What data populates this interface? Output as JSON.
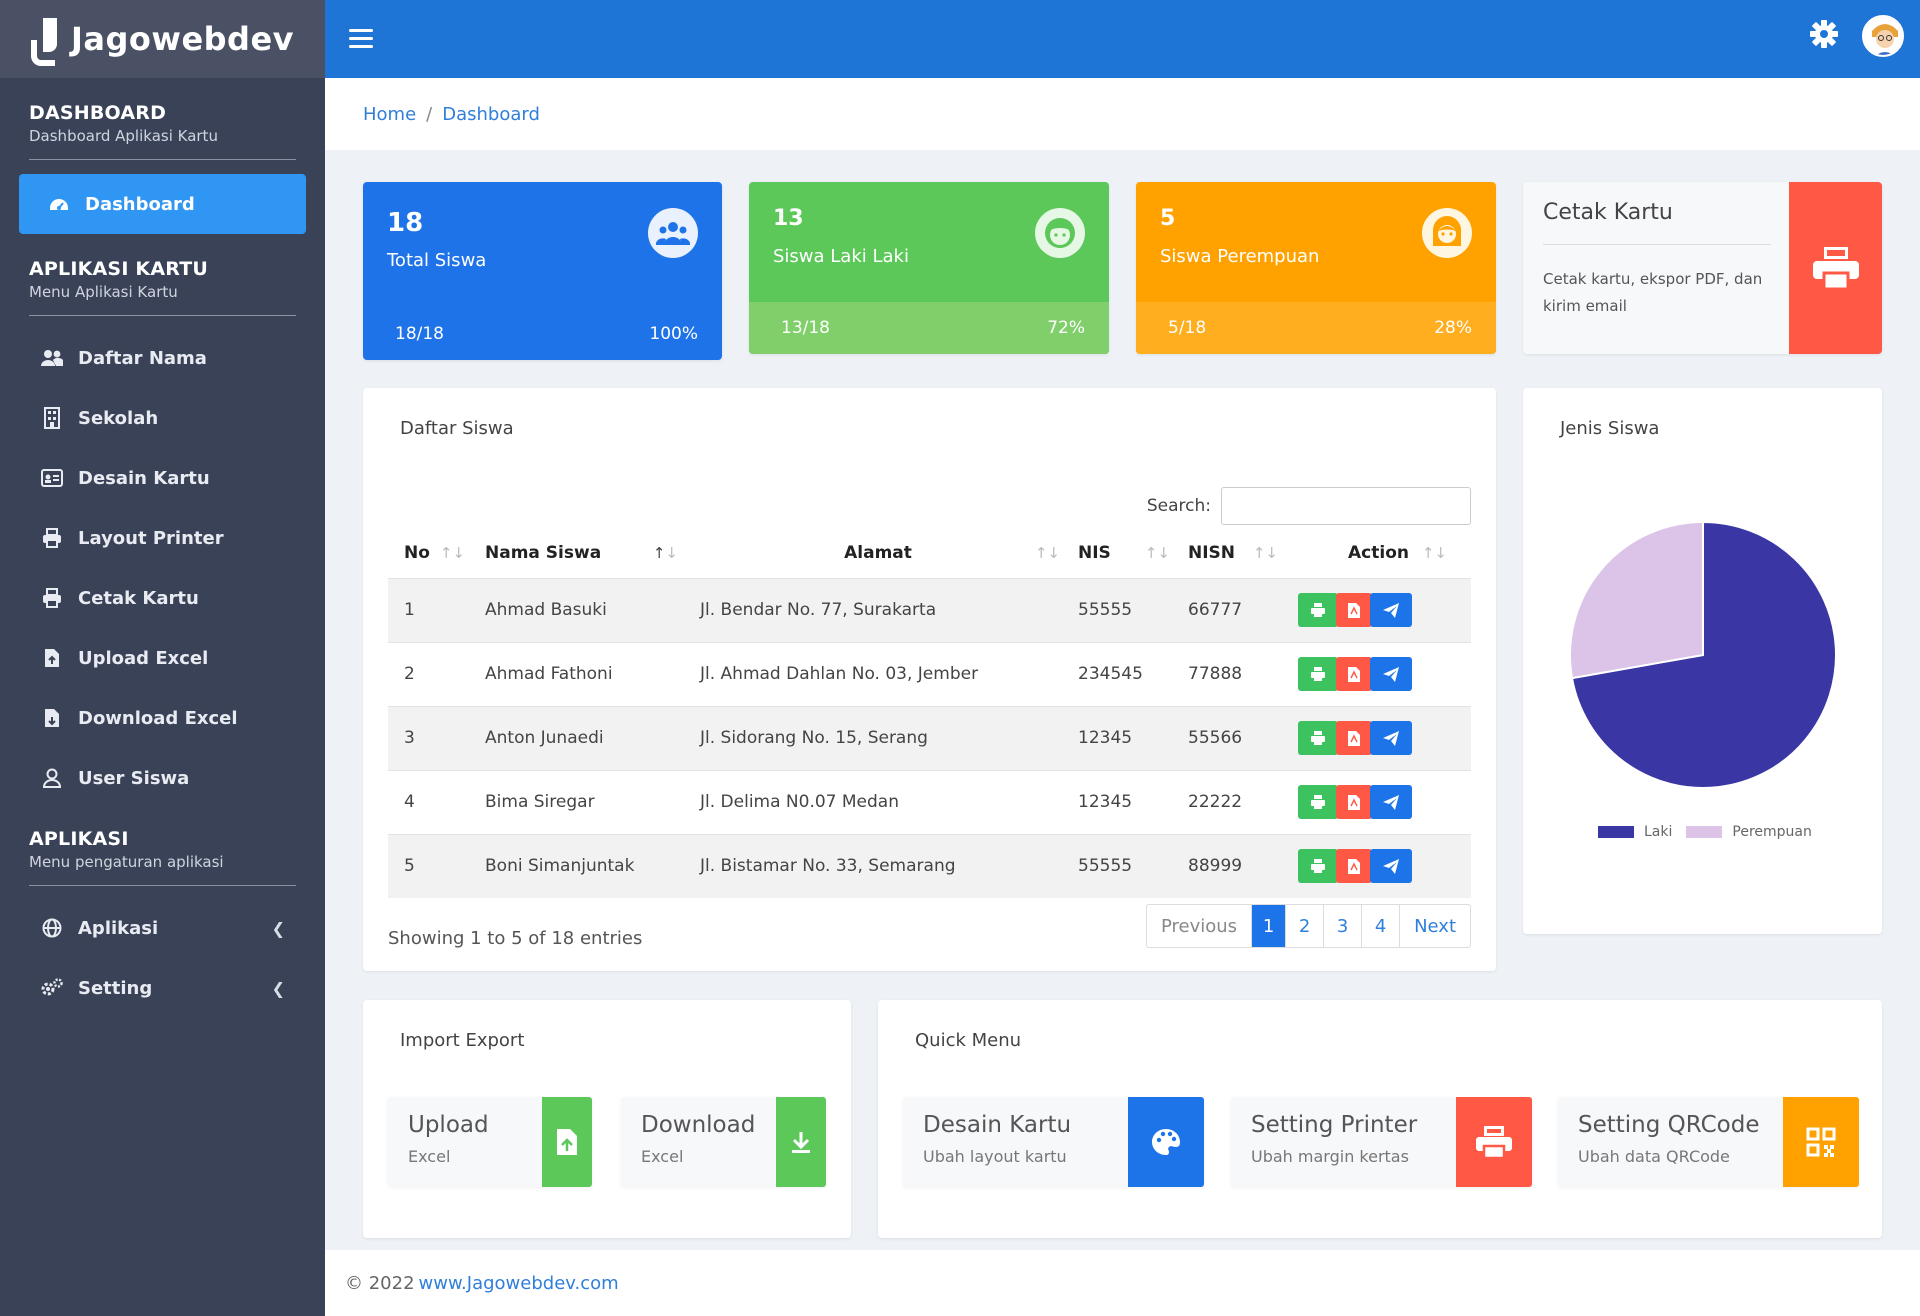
{
  "brand": {
    "name": "Jagowebdev"
  },
  "sidebar": {
    "sections": [
      {
        "title": "DASHBOARD",
        "subtitle": "Dashboard Aplikasi Kartu"
      },
      {
        "title": "APLIKASI KARTU",
        "subtitle": "Menu Aplikasi Kartu"
      },
      {
        "title": "APLIKASI",
        "subtitle": "Menu pengaturan aplikasi"
      }
    ],
    "items": [
      {
        "label": "Dashboard",
        "icon": "dashboard-icon"
      },
      {
        "label": "Daftar Nama",
        "icon": "users-icon"
      },
      {
        "label": "Sekolah",
        "icon": "building-icon"
      },
      {
        "label": "Desain Kartu",
        "icon": "id-card-icon"
      },
      {
        "label": "Layout Printer",
        "icon": "printer-icon"
      },
      {
        "label": "Cetak Kartu",
        "icon": "printer-icon"
      },
      {
        "label": "Upload Excel",
        "icon": "file-upload-icon"
      },
      {
        "label": "Download Excel",
        "icon": "file-download-icon"
      },
      {
        "label": "User Siswa",
        "icon": "user-icon"
      },
      {
        "label": "Aplikasi",
        "icon": "globe-icon"
      },
      {
        "label": "Setting",
        "icon": "gears-icon"
      }
    ]
  },
  "breadcrumb": {
    "home": "Home",
    "separator": "/",
    "current": "Dashboard"
  },
  "stats": [
    {
      "value": "18",
      "label": "Total Siswa",
      "ratio": "18/18",
      "percent": "100%",
      "color": "#1e73e8"
    },
    {
      "value": "13",
      "label": "Siswa Laki Laki",
      "ratio": "13/18",
      "percent": "72%",
      "color": "#5cc85a"
    },
    {
      "value": "5",
      "label": "Siswa Perempuan",
      "ratio": "5/18",
      "percent": "28%",
      "color": "#ffa200"
    }
  ],
  "cetak": {
    "title": "Cetak Kartu",
    "desc": "Cetak kartu, ekspor PDF, dan kirim email"
  },
  "table": {
    "title": "Daftar Siswa",
    "search_label": "Search:",
    "search_value": "",
    "columns": [
      "No",
      "Nama Siswa",
      "Alamat",
      "NIS",
      "NISN",
      "Action"
    ],
    "rows": [
      [
        "1",
        "Ahmad Basuki",
        "Jl. Bendar No. 77, Surakarta",
        "55555",
        "66777"
      ],
      [
        "2",
        "Ahmad Fathoni",
        "Jl. Ahmad Dahlan No. 03, Jember",
        "234545",
        "77888"
      ],
      [
        "3",
        "Anton Junaedi",
        "Jl. Sidorang No. 15, Serang",
        "12345",
        "55566"
      ],
      [
        "4",
        "Bima Siregar",
        "Jl. Delima N0.07 Medan",
        "12345",
        "22222"
      ],
      [
        "5",
        "Boni Simanjuntak",
        "Jl. Bistamar No. 33, Semarang",
        "55555",
        "88999"
      ]
    ],
    "info": "Showing 1 to 5 of 18 entries",
    "pagination": {
      "previous": "Previous",
      "pages": [
        "1",
        "2",
        "3",
        "4"
      ],
      "current": "1",
      "next": "Next"
    }
  },
  "pie_title": "Jenis Siswa",
  "chart_data": {
    "type": "pie",
    "categories": [
      "Laki",
      "Perempuan"
    ],
    "values": [
      13,
      5
    ],
    "colors": [
      "#3a37a4",
      "#dcc3e8"
    ],
    "legend": "bottom"
  },
  "import_export": {
    "title": "Import Export",
    "items": [
      {
        "title": "Upload",
        "sub": "Excel",
        "icon": "file-upload-icon",
        "color": "#5cc85a"
      },
      {
        "title": "Download",
        "sub": "Excel",
        "icon": "download-icon",
        "color": "#5cc85a"
      }
    ]
  },
  "quick_menu": {
    "title": "Quick Menu",
    "items": [
      {
        "title": "Desain Kartu",
        "sub": "Ubah layout kartu",
        "icon": "palette-icon",
        "color": "#1d74e8"
      },
      {
        "title": "Setting Printer",
        "sub": "Ubah margin kertas",
        "icon": "printer-icon",
        "color": "#ff5845"
      },
      {
        "title": "Setting QRCode",
        "sub": "Ubah data QRCode",
        "icon": "qrcode-icon",
        "color": "#ffa200"
      }
    ]
  },
  "footer": {
    "copy": "© 2022",
    "link": "www.Jagowebdev.com"
  }
}
